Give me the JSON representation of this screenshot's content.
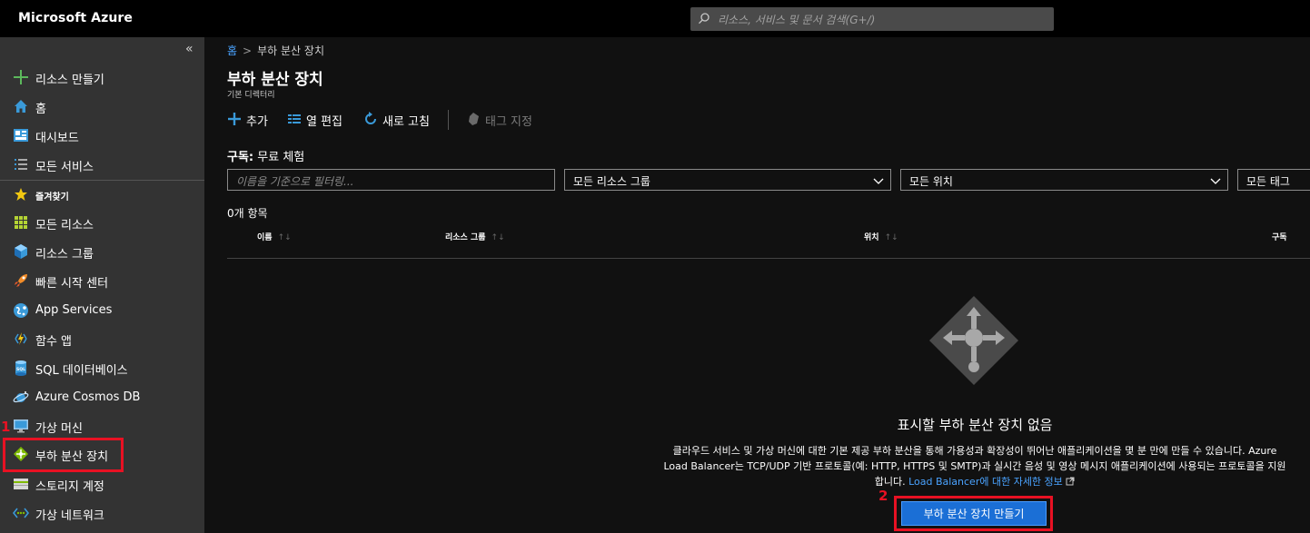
{
  "topbar": {
    "brand": "Microsoft Azure",
    "search_placeholder": "리소스, 서비스 및 문서 검색(G+/)"
  },
  "sidebar": {
    "collapse": "«",
    "items": [
      {
        "label": "리소스 만들기",
        "icon": "plus-icon"
      },
      {
        "label": "홈",
        "icon": "home-icon"
      },
      {
        "label": "대시보드",
        "icon": "dashboard-icon"
      },
      {
        "label": "모든 서비스",
        "icon": "list-icon"
      },
      {
        "label": "즐겨찾기",
        "icon": "star-icon"
      },
      {
        "label": "모든 리소스",
        "icon": "grid-icon"
      },
      {
        "label": "리소스 그룹",
        "icon": "cube-icon"
      },
      {
        "label": "빠른 시작 센터",
        "icon": "rocket-icon"
      },
      {
        "label": "App Services",
        "icon": "globe-icon"
      },
      {
        "label": "함수 앱",
        "icon": "lightning-icon"
      },
      {
        "label": "SQL 데이터베이스",
        "icon": "sql-database-icon"
      },
      {
        "label": "Azure Cosmos DB",
        "icon": "planet-icon"
      },
      {
        "label": "가상 머신",
        "icon": "monitor-icon"
      },
      {
        "label": "부하 분산 장치",
        "icon": "load-balancer-icon"
      },
      {
        "label": "스토리지 계정",
        "icon": "storage-icon"
      },
      {
        "label": "가상 네트워크",
        "icon": "network-icon"
      }
    ]
  },
  "annotations": {
    "step1": "1",
    "step2": "2"
  },
  "main": {
    "breadcrumb": {
      "home": "홈",
      "sep": ">",
      "current": "부하 분산 장치"
    },
    "title": "부하 분산 장치",
    "subtitle": "기본 디렉터리",
    "toolbar": {
      "add": "추가",
      "columns": "열 편집",
      "refresh": "새로 고침",
      "tags": "태그 지정"
    },
    "subscription_label": "구독:",
    "subscription_value": "무료 체험",
    "filter_placeholder": "이름을 기준으로 필터링...",
    "filters": {
      "resource_group": "모든 리소스 그룹",
      "location": "모든 위치",
      "tags": "모든 태그"
    },
    "item_count": "0개 항목",
    "columns": {
      "name": "이름",
      "resource_group": "리소스 그룹",
      "location": "위치",
      "subscription": "구독",
      "sort": "↑↓"
    },
    "empty": {
      "title": "표시할 부하 분산 장치 없음",
      "description": "클라우드 서비스 및 가상 머신에 대한 기본 제공 부하 분산을 통해 가용성과 확장성이 뛰어난 애플리케이션을 몇 분 만에 만들 수 있습니다. Azure Load Balancer는 TCP/UDP 기반 프로토콜(예: HTTP, HTTPS 및 SMTP)과 실시간 음성 및 영상 메시지 애플리케이션에 사용되는 프로토콜을 지원합니다.",
      "link": "Load Balancer에 대한 자세한 정보",
      "create_button": "부하 분산 장치 만들기"
    }
  },
  "colors": {
    "accent": "#1b6fd6",
    "link": "#4aa3ff",
    "annotation": "#e81123",
    "sidebar_bg": "#333333",
    "topbar_bg": "#000000"
  }
}
